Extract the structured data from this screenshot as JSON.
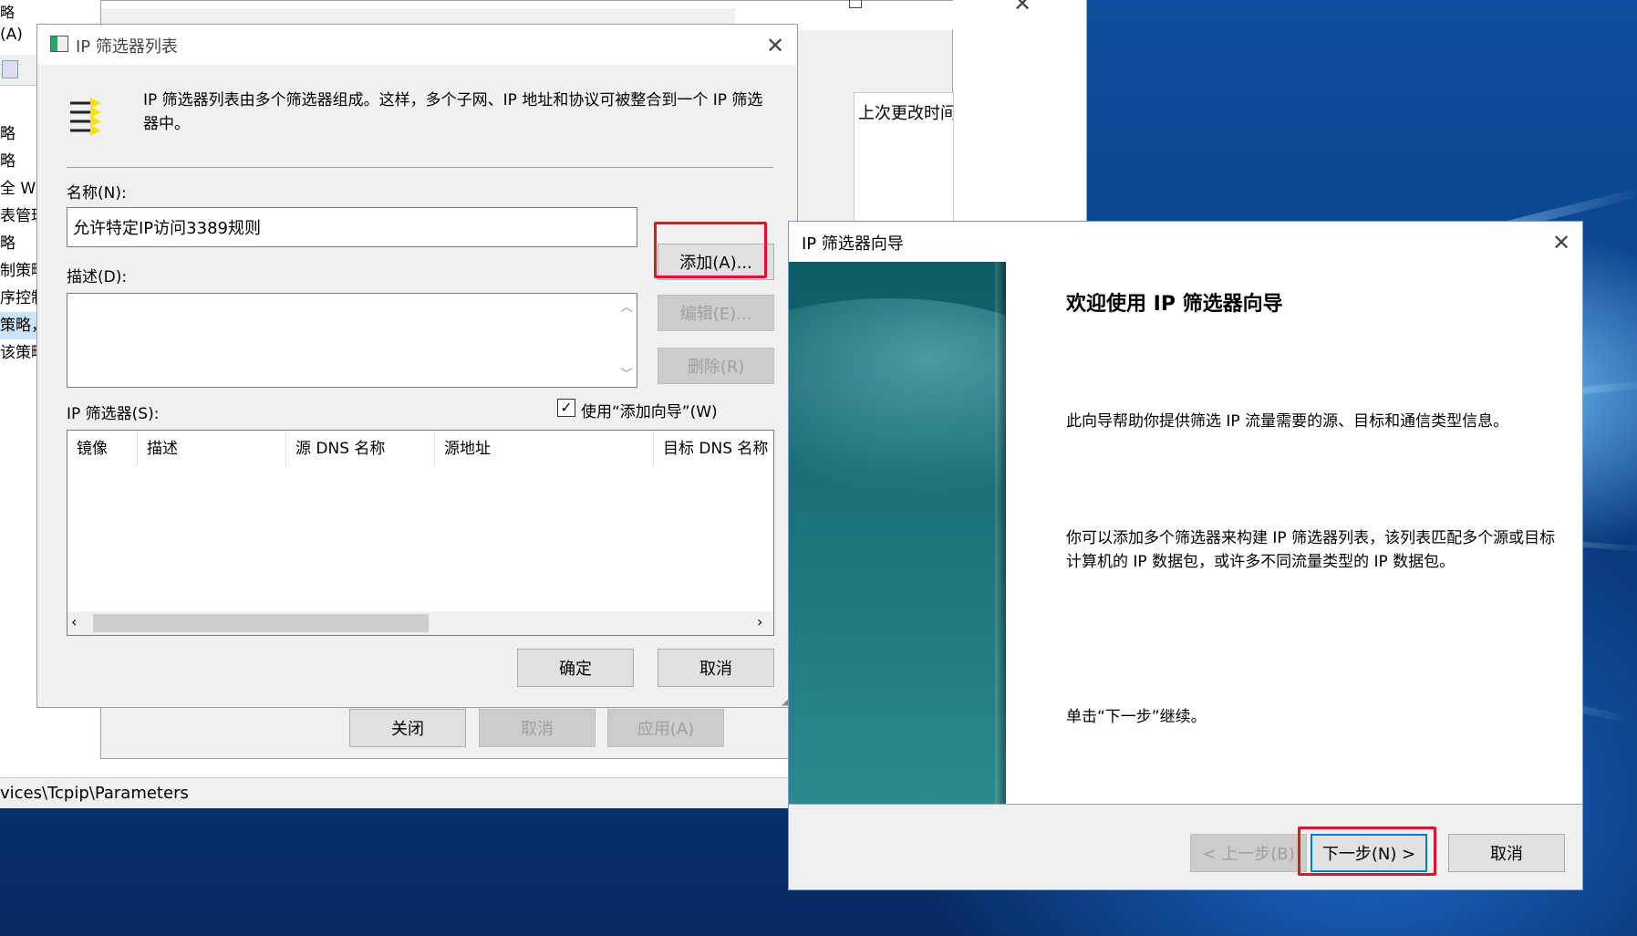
{
  "background_console": {
    "menu_partial": "(A)",
    "top_partial": "略",
    "tree_items": [
      "略",
      "略",
      "全 Wir",
      "表管理",
      "略",
      "制策略",
      "序控制",
      "策略，",
      "该策略"
    ],
    "column_header": "上次更改时间",
    "status_path": "vices\\Tcpip\\Parameters"
  },
  "background_dialog": {
    "close_label": "关闭",
    "cancel_label": "取消",
    "apply_label": "应用(A)"
  },
  "filter_list_dialog": {
    "title": "IP 筛选器列表",
    "description": "IP 筛选器列表由多个筛选器组成。这样，多个子网、IP 地址和协议可被整合到一个 IP 筛选器中。",
    "name_label": "名称(N):",
    "name_value": "允许特定IP访问3389规则",
    "desc_label": "描述(D):",
    "desc_value": "",
    "add_label": "添加(A)...",
    "edit_label": "编辑(E)...",
    "delete_label": "删除(R)",
    "filters_label": "IP 筛选器(S):",
    "wizard_checkbox_label": "使用“添加向导”(W)",
    "wizard_checkbox_checked": true,
    "columns": [
      "镜像",
      "描述",
      "源 DNS 名称",
      "源地址",
      "目标 DNS 名称"
    ],
    "ok_label": "确定",
    "cancel_label": "取消"
  },
  "wizard": {
    "title": "IP 筛选器向导",
    "heading": "欢迎使用 IP 筛选器向导",
    "paragraph1": "此向导帮助你提供筛选 IP 流量需要的源、目标和通信类型信息。",
    "paragraph2": "你可以添加多个筛选器来构建 IP 筛选器列表，该列表匹配多个源或目标计算机的 IP 数据包，或许多不同流量类型的 IP 数据包。",
    "paragraph3": "单击“下一步”继续。",
    "back_label": "< 上一步(B)",
    "next_label": "下一步(N) >",
    "cancel_label": "取消"
  },
  "colors": {
    "highlight": "#e81123",
    "accent": "#0078d7",
    "wizard_banner": "#1a6e78"
  }
}
